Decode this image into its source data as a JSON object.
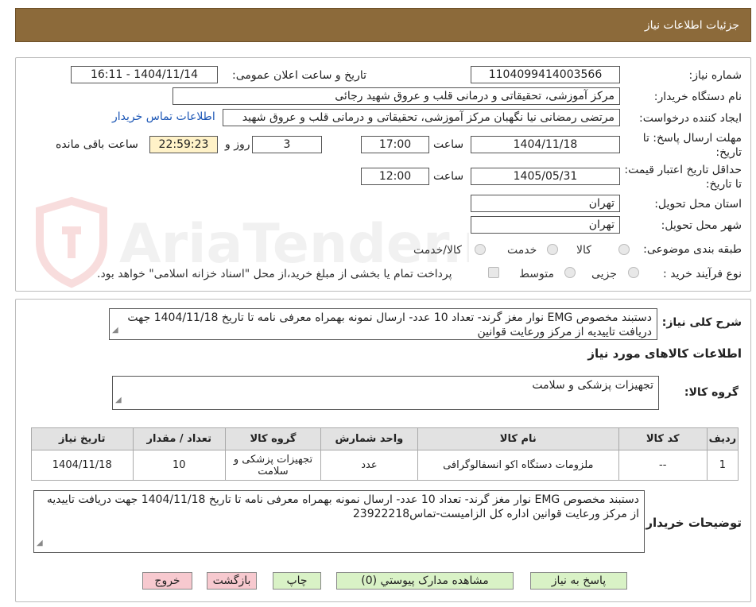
{
  "header": {
    "title": "جزئیات اطلاعات نیاز"
  },
  "form": {
    "need_no_label": "شماره نیاز:",
    "need_no": "1104099414003566",
    "announce_label": "تاریخ و ساعت اعلان عمومی:",
    "announce_value": "1404/11/14 - 16:11",
    "buyer_label": "نام دستگاه خریدار:",
    "buyer_value": "مرکز آموزشی، تحقیقاتی و درمانی قلب و عروق شهید رجائی",
    "creator_label": "ایجاد کننده درخواست:",
    "creator_value": "مرتضی رمضانی نیا نگهبان مرکز آموزشی، تحقیقاتی و درمانی قلب و عروق شهید",
    "contact_link": "اطلاعات تماس خریدار",
    "deadline_label": "مهلت ارسال پاسخ: تا تاریخ:",
    "deadline_date": "1404/11/18",
    "time_label": "ساعت",
    "deadline_time": "17:00",
    "days_value": "3",
    "days_label": "روز و",
    "remaining_time": "22:59:23",
    "remaining_label": "ساعت باقی مانده",
    "validity_label": "حداقل تاریخ اعتبار قیمت: تا تاریخ:",
    "validity_date": "1405/05/31",
    "validity_time": "12:00",
    "province_label": "استان محل تحویل:",
    "province_value": "تهران",
    "city_label": "شهر محل تحویل:",
    "city_value": "تهران",
    "category_label": "طبقه بندی موضوعی:",
    "cat_goods": "کالا",
    "cat_service": "خدمت",
    "cat_both": "کالا/خدمت",
    "process_label": "نوع فرآیند خرید :",
    "proc_partial": "جزیی",
    "proc_medium": "متوسط",
    "payment_note": "پرداخت تمام یا بخشی از مبلغ خرید،از محل \"اسناد خزانه اسلامی\" خواهد بود."
  },
  "summary": {
    "label": "شرح کلی نیاز:",
    "text": "دستبند مخصوص EMG نوار مغز گرند-  تعداد 10 عدد- ارسال نمونه بهمراه معرفی نامه تا تاریخ 1404/11/18 جهت دریافت تاییدیه از مرکز ورعایت قوانین",
    "goods_title": "اطلاعات کالاهای مورد نیاز",
    "group_label": "گروه کالا:",
    "group_value": "تجهیزات پزشکی و سلامت"
  },
  "table": {
    "headers": [
      "ردیف",
      "کد کالا",
      "نام کالا",
      "واحد شمارش",
      "گروه کالا",
      "تعداد / مقدار",
      "تاریخ نیاز"
    ],
    "rows": [
      [
        "1",
        "--",
        "ملزومات دستگاه اکو انسفالوگرافی",
        "عدد",
        "تجهیزات پزشکی و سلامت",
        "10",
        "1404/11/18"
      ]
    ]
  },
  "buyer_notes": {
    "label": "توضیحات خریدار:",
    "text": "دستبند مخصوص EMG نوار مغز گرند-  تعداد 10 عدد- ارسال نمونه بهمراه معرفی نامه تا تاریخ 1404/11/18 جهت دریافت تاییدیه از مرکز ورعایت قوانین اداره کل الزامیست-تماس23922218"
  },
  "buttons": {
    "reply": "پاسخ به نیاز",
    "attachments": "مشاهده مدارک پیوستي (0)",
    "print": "چاپ",
    "back": "بازگشت",
    "exit": "خروج"
  },
  "watermark": {
    "text": "AriaTender.neT"
  },
  "colors": {
    "header_bg": "#8c6a3a",
    "green_btn": "#d9f2c6",
    "pink_btn": "#f7c9cf",
    "remaining_bg": "#fff2c8"
  }
}
